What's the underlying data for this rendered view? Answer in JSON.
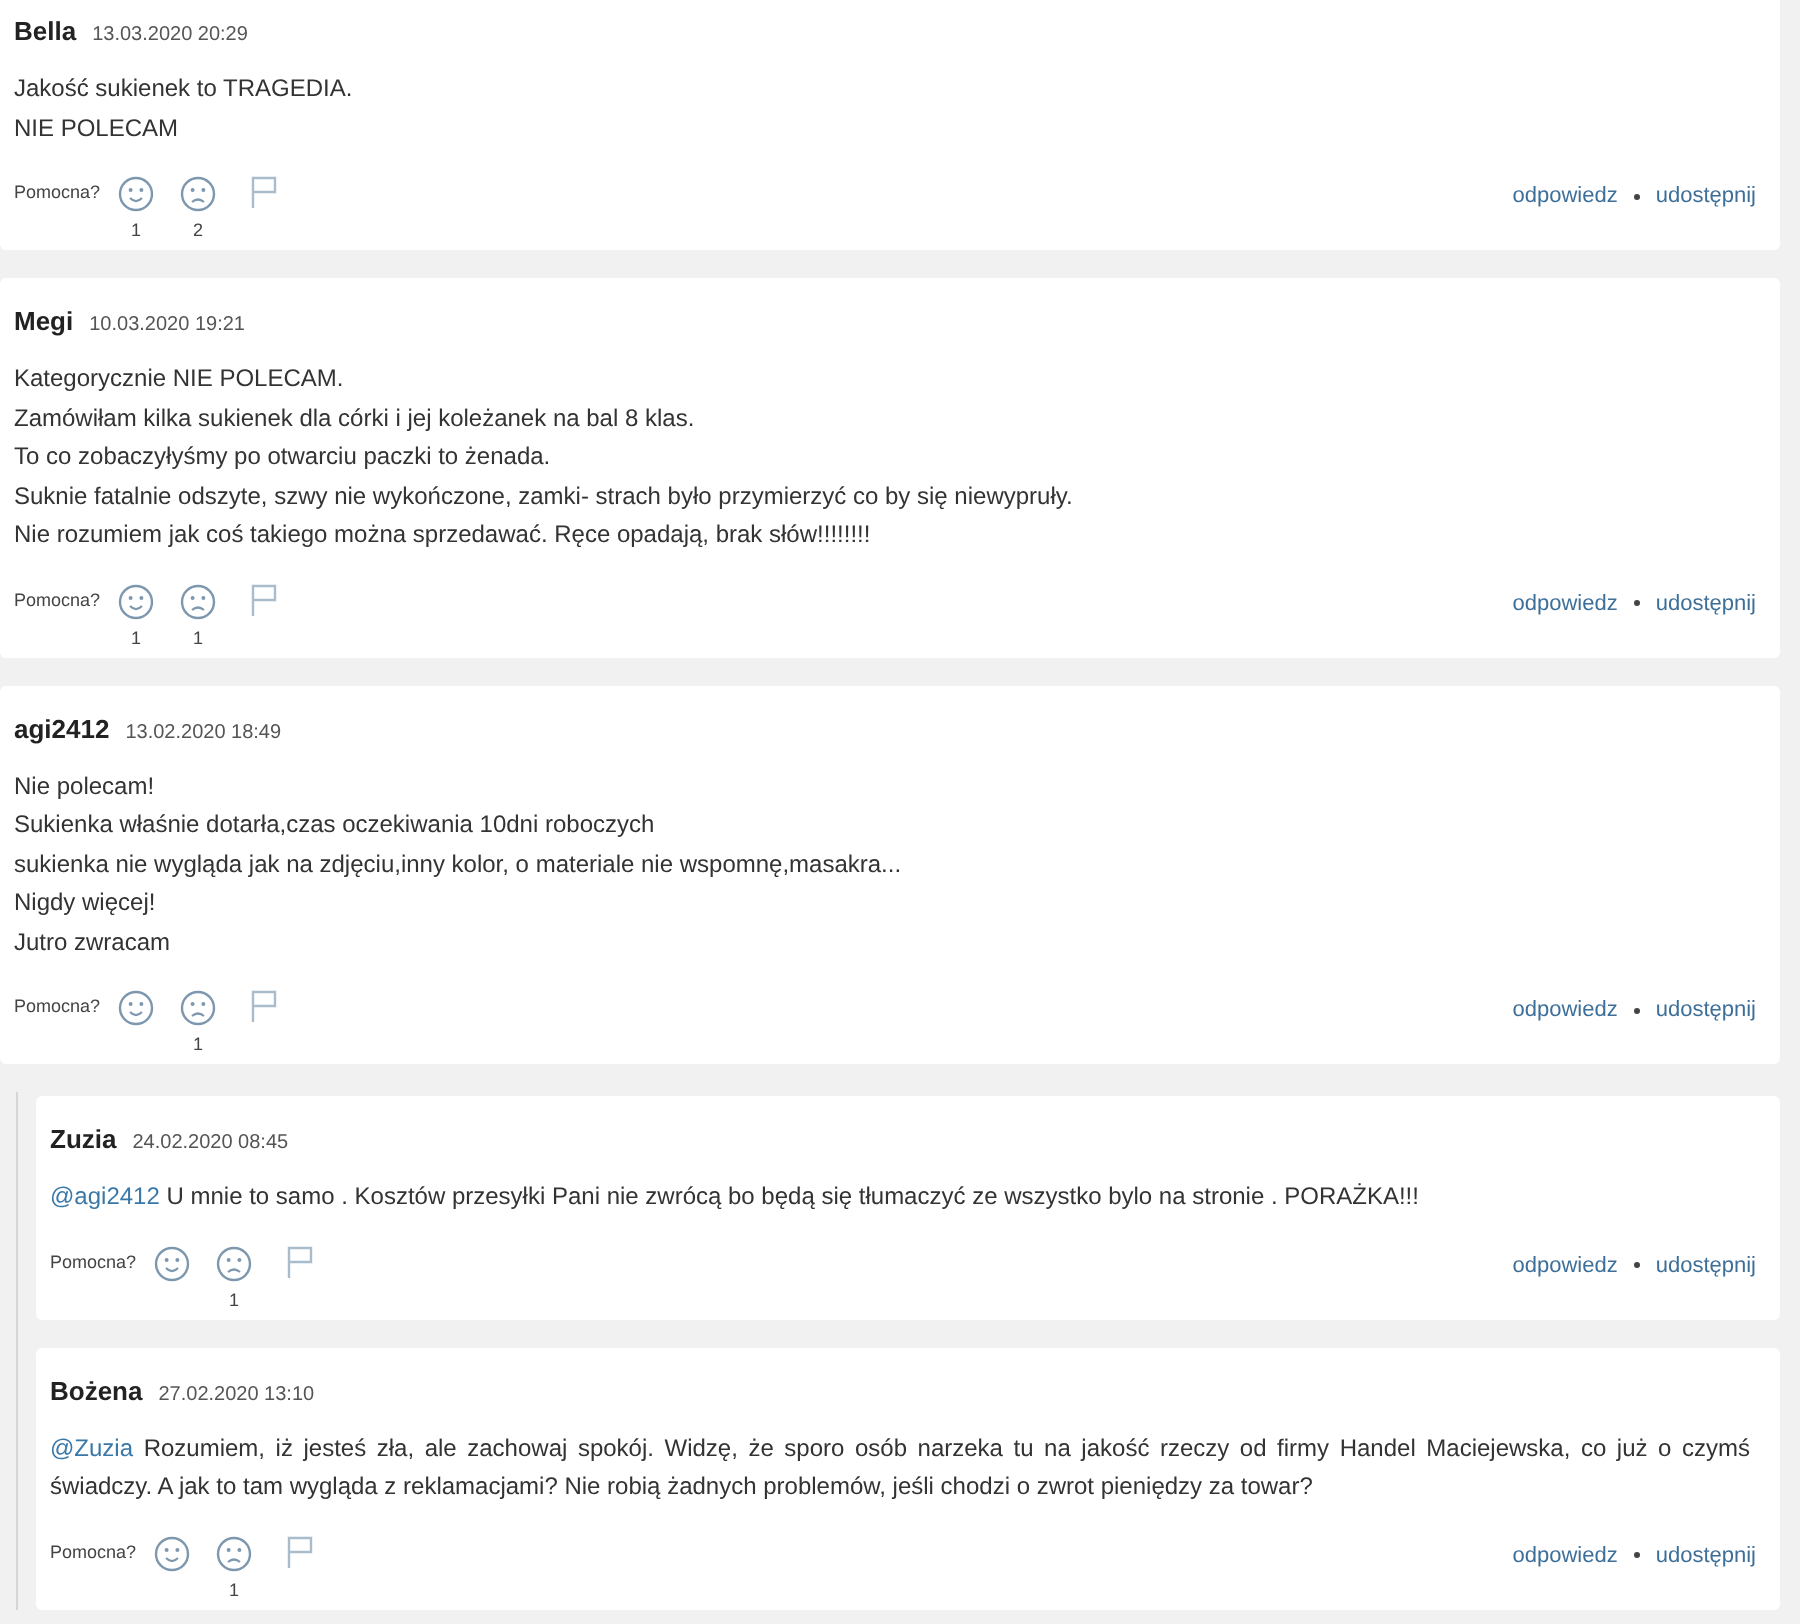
{
  "comments": [
    {
      "author": "Bella",
      "date": "13.03.2020 20:29",
      "lines": [
        "Jakość sukienek to TRAGEDIA.",
        "NIE POLECAM"
      ],
      "helpful_label": "Pomocna?",
      "likes": "1",
      "dislikes": "2",
      "actions": [
        "odpowiedz",
        "udostępnij"
      ]
    },
    {
      "author": "Megi",
      "date": "10.03.2020 19:21",
      "lines": [
        "Kategorycznie NIE POLECAM.",
        "Zamówiłam kilka sukienek dla córki i jej koleżanek na bal 8 klas.",
        "To co zobaczyłyśmy po otwarciu paczki to żenada.",
        "Suknie fatalnie odszyte, szwy nie wykończone, zamki- strach było przymierzyć co by się niewypruły.",
        "Nie rozumiem jak coś takiego można sprzedawać. Ręce opadają, brak słów!!!!!!!!"
      ],
      "helpful_label": "Pomocna?",
      "likes": "1",
      "dislikes": "1",
      "actions": [
        "odpowiedz",
        "udostępnij"
      ]
    },
    {
      "author": "agi2412",
      "date": "13.02.2020 18:49",
      "lines": [
        "Nie polecam!",
        "Sukienka właśnie dotarła,czas oczekiwania 10dni roboczych",
        "sukienka nie wygląda jak na zdjęciu,inny kolor, o materiale nie wspomnę,masakra...",
        "Nigdy więcej!",
        "Jutro zwracam"
      ],
      "helpful_label": "Pomocna?",
      "dislikes": "1",
      "actions": [
        "odpowiedz",
        "udostępnij"
      ],
      "replies": [
        {
          "author": "Zuzia",
          "date": "24.02.2020 08:45",
          "mention": "@agi2412",
          "text": "U mnie to samo . Kosztów przesyłki Pani nie zwrócą bo będą się tłumaczyć ze wszystko bylo na stronie . PORAŻKA!!!",
          "helpful_label": "Pomocna?",
          "dislikes": "1",
          "actions": [
            "odpowiedz",
            "udostępnij"
          ]
        },
        {
          "author": "Bożena",
          "date": "27.02.2020 13:10",
          "mention": "@Zuzia",
          "text": "Rozumiem, iż jesteś zła, ale zachowaj spokój. Widzę, że sporo osób narzeka tu na jakość rzeczy od firmy Handel Maciejewska, co już o czymś świadczy. A jak to tam wygląda z reklamacjami? Nie robią żadnych problemów, jeśli chodzi o zwrot pieniędzy za towar?",
          "helpful_label": "Pomocna?",
          "dislikes": "1",
          "actions": [
            "odpowiedz",
            "udostępnij"
          ]
        }
      ]
    }
  ]
}
